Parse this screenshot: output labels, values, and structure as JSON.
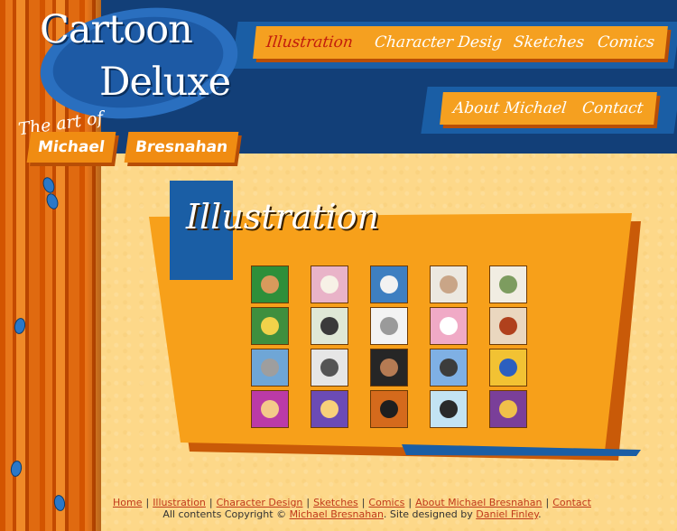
{
  "logo": {
    "title_line1": "Cartoon",
    "title_line2": "Deluxe",
    "tagline": "The art of",
    "name_first": "Michael",
    "name_last": "Bresnahan"
  },
  "nav": {
    "illustration": "Illustration",
    "character_design": "Character Design",
    "sketches": "Sketches",
    "comics": "Comics",
    "about": "About Michael",
    "contact": "Contact"
  },
  "section": {
    "title": "Illustration"
  },
  "thumbnails": [
    {
      "color": "#2e8f3a",
      "accent": "#d99a5c"
    },
    {
      "color": "#e9b3c8",
      "accent": "#f7f1e6"
    },
    {
      "color": "#3e7fc1",
      "accent": "#f2f2f2"
    },
    {
      "color": "#ece8e0",
      "accent": "#c9a587"
    },
    {
      "color": "#f1ede2",
      "accent": "#7d9c5f"
    },
    {
      "color": "#3f8f3e",
      "accent": "#f1d24a"
    },
    {
      "color": "#dfe8d6",
      "accent": "#3a3a3a"
    },
    {
      "color": "#f3f3f3",
      "accent": "#9a9a9a"
    },
    {
      "color": "#f0aac6",
      "accent": "#ffffff"
    },
    {
      "color": "#ead7bf",
      "accent": "#b0411d"
    },
    {
      "color": "#6fa6d6",
      "accent": "#9e9e9e"
    },
    {
      "color": "#e6e6e6",
      "accent": "#555555"
    },
    {
      "color": "#262626",
      "accent": "#b57b53"
    },
    {
      "color": "#7fb0e4",
      "accent": "#3c3c3c"
    },
    {
      "color": "#f2c233",
      "accent": "#2c5fbf"
    },
    {
      "color": "#bb3aa7",
      "accent": "#f4c98a"
    },
    {
      "color": "#6b4bb5",
      "accent": "#f7d07a"
    },
    {
      "color": "#d56a1c",
      "accent": "#1f1f1f"
    },
    {
      "color": "#c3e3f3",
      "accent": "#2a2a2a"
    },
    {
      "color": "#7a3f99",
      "accent": "#f0c04a"
    }
  ],
  "footer": {
    "links": [
      "Home",
      "Illustration",
      "Character Design",
      "Sketches",
      "Comics",
      "About Michael Bresnahan",
      "Contact"
    ],
    "copyright_prefix": "All contents Copyright © ",
    "owner": "Michael Bresnahan",
    "designed_by_prefix": ". Site designed by ",
    "designer": "Daniel Finley",
    "suffix": "."
  },
  "colors": {
    "header_blue": "#123f78",
    "accent_orange": "#f5a020",
    "active_red": "#c21c0c"
  }
}
